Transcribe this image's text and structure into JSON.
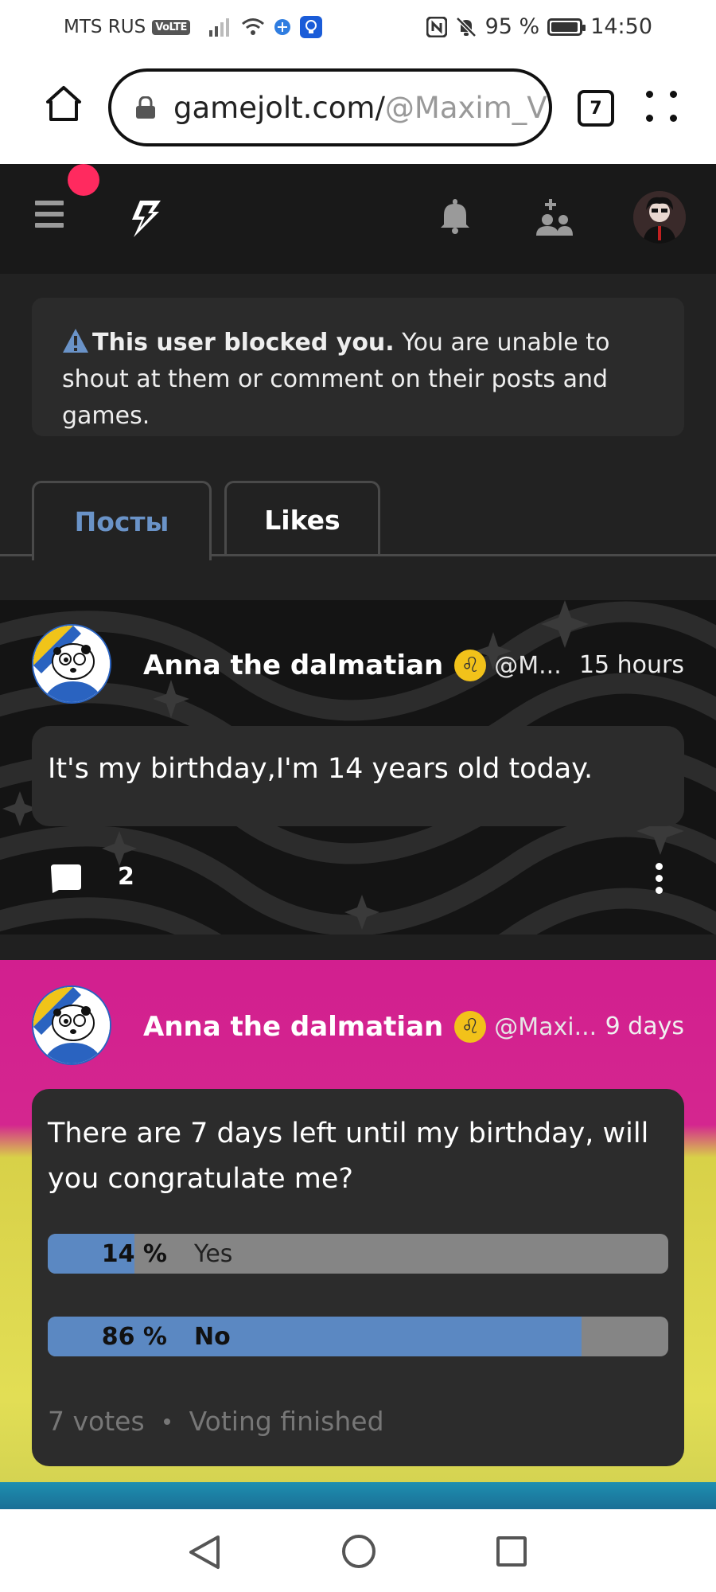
{
  "status_bar": {
    "carrier": "MTS RUS",
    "volte": "VoLTE",
    "battery": "95 %",
    "time": "14:50"
  },
  "browser": {
    "url_main": "gamejolt.com/",
    "url_rest": "@Maxim_V",
    "tab_count": "7"
  },
  "notice": {
    "bold": "This user blocked you.",
    "text": " You are unable to shout at them or comment on their posts and games."
  },
  "tabs": [
    {
      "label": "Посты",
      "active": true
    },
    {
      "label": "Likes",
      "active": false
    }
  ],
  "posts": [
    {
      "author": "Anna the dalmatian",
      "handle": "@M...",
      "time": "15 hours",
      "text": "It's my birthday,I'm 14 years old today.",
      "comments": "2"
    },
    {
      "author": "Anna the dalmatian",
      "handle": "@Maxi...",
      "time": "9 days",
      "text": "There are 7 days left until my birthday, will you congratulate me?",
      "poll": {
        "options": [
          {
            "percent": "14 %",
            "value": 0.14,
            "label": "Yes",
            "chosen": false
          },
          {
            "percent": "86 %",
            "value": 0.86,
            "label": "No",
            "chosen": true
          }
        ],
        "votes": "7 votes",
        "status": "Voting finished"
      }
    }
  ],
  "colors": {
    "accent": "#6a93c8",
    "poll_fill": "#5b88c2",
    "notification": "#ff2a5f"
  }
}
